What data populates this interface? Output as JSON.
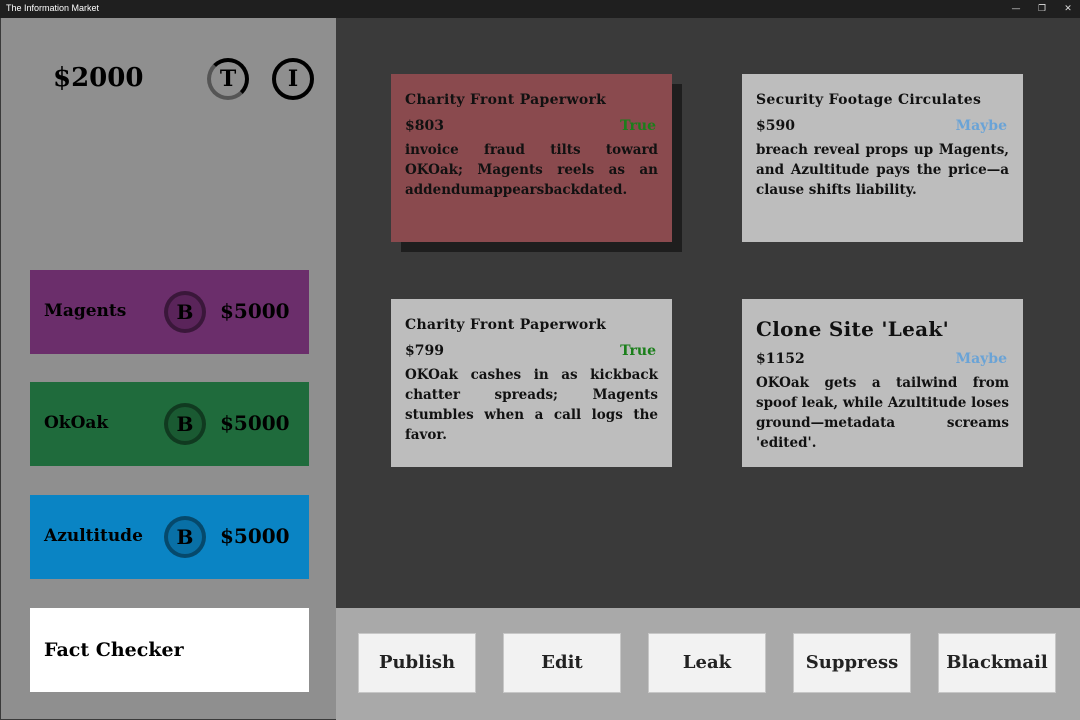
{
  "window": {
    "title": "The Information Market",
    "minimize_icon": "—",
    "restore_icon": "❐",
    "close_icon": "✕"
  },
  "player": {
    "money": "$2000",
    "t_button": "T",
    "i_button": "I"
  },
  "companies": [
    {
      "name": "Magents",
      "button": "B",
      "cash": "$5000",
      "color": "#6b2e6b"
    },
    {
      "name": "OkOak",
      "button": "B",
      "cash": "$5000",
      "color": "#1f6b3c"
    },
    {
      "name": "Azultitude",
      "button": "B",
      "cash": "$5000",
      "color": "#0a84c4"
    }
  ],
  "fact_checker": {
    "label": "Fact Checker"
  },
  "cards": [
    {
      "title": "Charity Front Paperwork",
      "price": "$803",
      "verdict": "True",
      "description": "invoice fraud tilts toward OKOak; Magents reels as an addendumappearsbackdated."
    },
    {
      "title": "Security Footage Circulates",
      "price": "$590",
      "verdict": "Maybe",
      "description": "breach reveal props up Magents, and Azultitude pays the price—a clause shifts liability."
    },
    {
      "title": "Charity Front Paperwork",
      "price": "$799",
      "verdict": "True",
      "description": "OKOak cashes in as kickback chatter spreads; Magents stumbles when a call logs the favor."
    },
    {
      "title": "Clone Site 'Leak'",
      "price": "$1152",
      "verdict": "Maybe",
      "description": "OKOak gets a tailwind from spoof leak, while Azultitude loses ground—metadata screams 'edited'."
    }
  ],
  "actions": {
    "publish": "Publish",
    "edit": "Edit",
    "leak": "Leak",
    "suppress": "Suppress",
    "blackmail": "Blackmail"
  },
  "colors": {
    "true": "#1a7f1a",
    "maybe": "#6aa3d6",
    "selected_card": "#8a4a4e",
    "card": "#bdbdbd"
  }
}
